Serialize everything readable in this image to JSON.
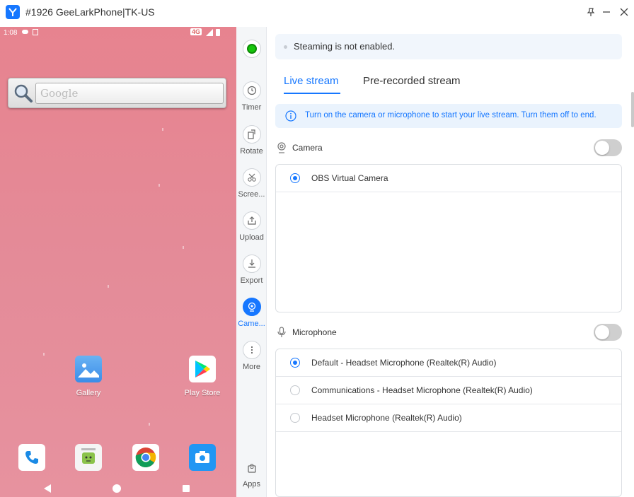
{
  "window": {
    "title": "#1926 GeeLarkPhone|TK-US",
    "pin_icon": "pin-icon",
    "minimize_icon": "minimize-icon",
    "close_icon": "close-icon"
  },
  "phone": {
    "status": {
      "time": "1:08",
      "network": "4G"
    },
    "search": {
      "placeholder": "Google"
    },
    "apps": [
      {
        "label": "Gallery",
        "icon": "gallery-icon"
      },
      {
        "label": "Play Store",
        "icon": "play-store-icon"
      }
    ],
    "dock": [
      {
        "icon": "phone-icon"
      },
      {
        "icon": "messaging-icon"
      },
      {
        "icon": "chrome-icon"
      },
      {
        "icon": "camera-icon"
      }
    ],
    "nav": [
      "back",
      "home",
      "recents"
    ]
  },
  "toolbar": {
    "status_color": "#16c60c",
    "items": [
      {
        "label": "Timer",
        "icon": "clock-icon"
      },
      {
        "label": "Rotate",
        "icon": "rotate-icon"
      },
      {
        "label": "Scree...",
        "icon": "screenshot-icon"
      },
      {
        "label": "Upload",
        "icon": "upload-icon"
      },
      {
        "label": "Export",
        "icon": "download-icon"
      },
      {
        "label": "Came...",
        "icon": "camera-stream-icon"
      },
      {
        "label": "More",
        "icon": "more-icon"
      }
    ],
    "apps_label": "Apps"
  },
  "panel": {
    "notice": "Steaming is not enabled.",
    "tabs": [
      "Live stream",
      "Pre-recorded stream"
    ],
    "info": "Turn on the camera or microphone to start your live stream. Turn them off to end.",
    "accent": "#1677ff",
    "camera": {
      "title": "Camera",
      "enabled": false,
      "options": [
        {
          "label": "OBS Virtual Camera",
          "selected": true
        }
      ]
    },
    "microphone": {
      "title": "Microphone",
      "enabled": false,
      "options": [
        {
          "label": "Default - Headset Microphone (Realtek(R) Audio)",
          "selected": true
        },
        {
          "label": "Communications - Headset Microphone (Realtek(R) Audio)",
          "selected": false
        },
        {
          "label": "Headset Microphone (Realtek(R) Audio)",
          "selected": false
        }
      ]
    }
  }
}
